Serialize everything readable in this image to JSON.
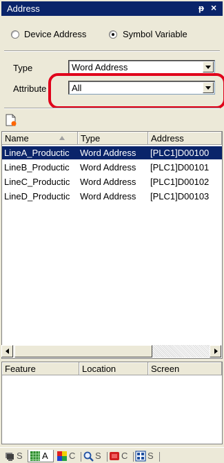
{
  "window": {
    "title": "Address",
    "pin_glyph": "ᵽ",
    "close_glyph": "×"
  },
  "mode": {
    "options": [
      {
        "label": "Device Address",
        "checked": false
      },
      {
        "label": "Symbol Variable",
        "checked": true
      }
    ]
  },
  "filters": {
    "type_label": "Type",
    "type_value": "Word Address",
    "attribute_label": "Attribute",
    "attribute_value": "All"
  },
  "toolbar": {
    "new_icon": "new-variable-icon"
  },
  "variables": {
    "columns": [
      "Name",
      "Type",
      "Address"
    ],
    "sort_column": "Name",
    "sort_direction": "ascending",
    "rows": [
      {
        "name": "LineA_Productic",
        "type": "Word Address",
        "address": "[PLC1]D00100",
        "selected": true
      },
      {
        "name": "LineB_Productic",
        "type": "Word Address",
        "address": "[PLC1]D00101",
        "selected": false
      },
      {
        "name": "LineC_Productic",
        "type": "Word Address",
        "address": "[PLC1]D00102",
        "selected": false
      },
      {
        "name": "LineD_Productic",
        "type": "Word Address",
        "address": "[PLC1]D00103",
        "selected": false
      }
    ]
  },
  "usage": {
    "columns": [
      "Feature",
      "Location",
      "Screen"
    ]
  },
  "tabs": [
    {
      "icon": "screen-list-icon",
      "label": "S",
      "active": false
    },
    {
      "icon": "address-grid-icon",
      "label": "A",
      "active": true
    },
    {
      "icon": "color-palette-icon",
      "label": "C",
      "active": false
    },
    {
      "icon": "search-icon",
      "label": "S",
      "active": false
    },
    {
      "icon": "common-settings-icon",
      "label": "C",
      "active": false
    },
    {
      "icon": "system-variable-icon",
      "label": "S",
      "active": false
    }
  ],
  "colors": {
    "selection": "#0a246a",
    "highlight": "#e0001a",
    "titlebar": "#0a246a"
  }
}
